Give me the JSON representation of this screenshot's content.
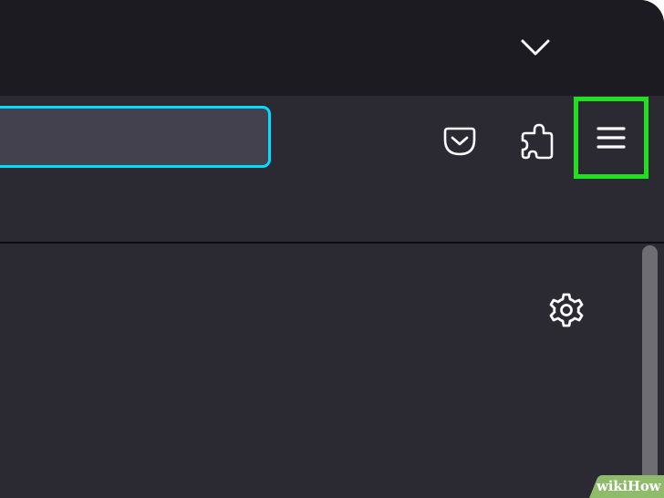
{
  "browser": {
    "url_bar": {
      "value": "",
      "placeholder": ""
    },
    "toolbar": {
      "buttons": [
        {
          "name": "save-to-pocket",
          "icon": "pocket-icon"
        },
        {
          "name": "extensions",
          "icon": "puzzle-icon"
        },
        {
          "name": "open-application-menu",
          "icon": "hamburger-menu-icon",
          "highlighted": true
        }
      ]
    },
    "tab_strip": {
      "list_all_tabs_icon": "chevron-down-icon"
    },
    "content": {
      "settings_icon": "gear-icon"
    }
  },
  "colors": {
    "window_bg": "#1c1b22",
    "toolbar_bg": "#2b2a33",
    "url_field_bg": "#42414d",
    "url_focus_ring": "#00ddff",
    "highlight_box": "#21e021",
    "icon": "#fbfbfe"
  },
  "watermark": {
    "part1": "wiki",
    "part2": "How"
  }
}
